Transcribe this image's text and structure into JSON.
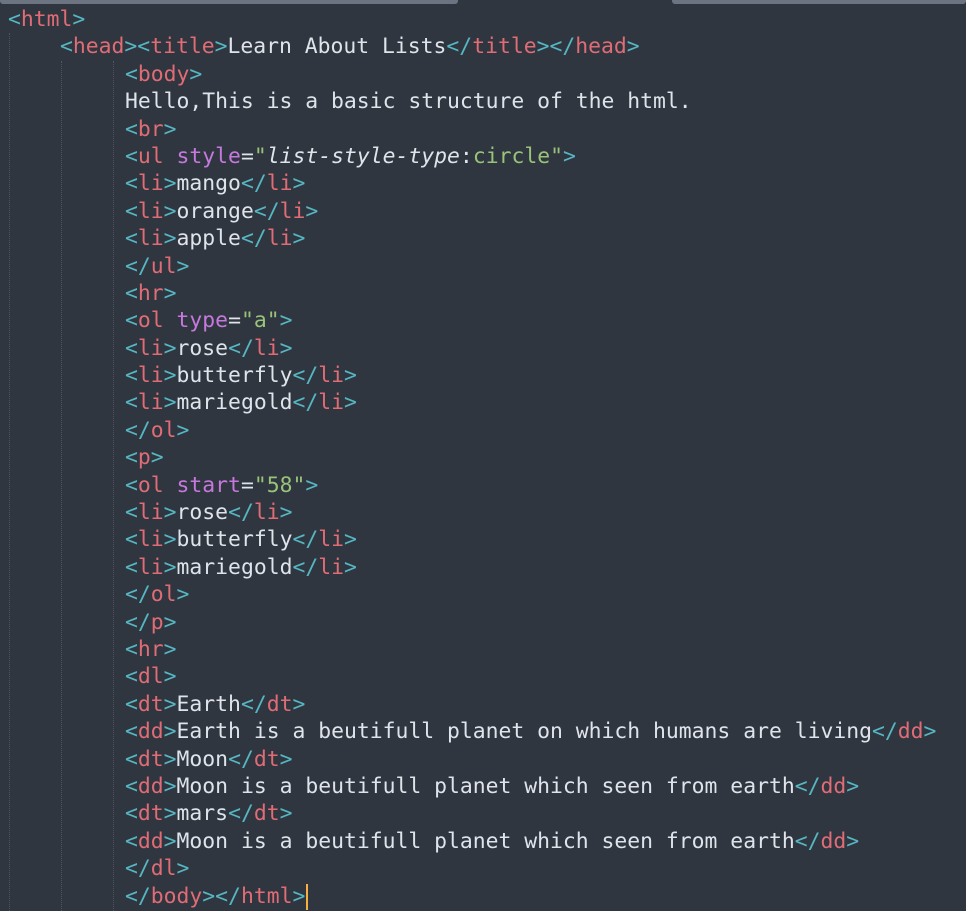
{
  "editor": {
    "language": "html",
    "colors": {
      "background": "#2f3640",
      "tag": "#e06c75",
      "bracket": "#56b6c2",
      "attribute": "#c678dd",
      "string": "#98c379",
      "text": "#dfe3ea",
      "cursor": "#f5b041"
    },
    "lines": [
      "<html>",
      "<head><title>Learn About Lists</title></head>",
      "<body>",
      "Hello,This is a basic structure of the html.",
      "<br>",
      "<ul style=\"list-style-type:circle\">",
      "<li>mango</li>",
      "<li>orange</li>",
      "<li>apple</li>",
      "</ul>",
      "<hr>",
      "<ol type=\"a\">",
      "<li>rose</li>",
      "<li>butterfly</li>",
      "<li>mariegold</li>",
      "</ol>",
      "<p>",
      "<ol start=\"58\">",
      "<li>rose</li>",
      "<li>butterfly</li>",
      "<li>mariegold</li>",
      "</ol>",
      "</p>",
      "<hr>",
      "<dl>",
      "<dt>Earth</dt>",
      "<dd>Earth is a beutifull planet on which humans are living</dd>",
      "<dt>Moon</dt>",
      "<dd>Moon is a beutifull planet which seen from earth</dd>",
      "<dt>mars</dt>",
      "<dd>Moon is a beutifull planet which seen from earth</dd>",
      "</dl>",
      "</body></html>"
    ]
  }
}
